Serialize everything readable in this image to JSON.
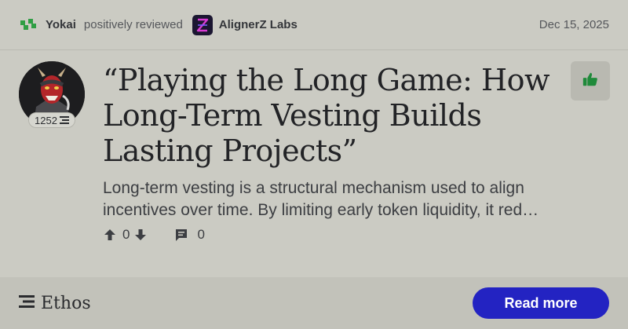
{
  "review": {
    "author": "Yokai",
    "action": "positively reviewed",
    "target": "AlignerZ Labs",
    "date": "Dec 15, 2025",
    "sentiment_icon": "thumbs-up-icon"
  },
  "avatar": {
    "score": "1252",
    "score_icon": "ethos-logo-icon"
  },
  "title": "“Playing the Long Game: How Long-Term Vesting Builds Lasting Projects”",
  "description": "Long-term vesting is a structural mechanism used to align incentives over time. By limiting early token liquidity, it red…",
  "stats": {
    "vote_count": "0",
    "comment_count": "0"
  },
  "footer": {
    "brand": "Ethos",
    "cta": "Read more"
  },
  "colors": {
    "background": "#cbcbc3",
    "footer": "#c2c2ba",
    "cta": "#2323c2",
    "positive": "#1f8a3a"
  }
}
